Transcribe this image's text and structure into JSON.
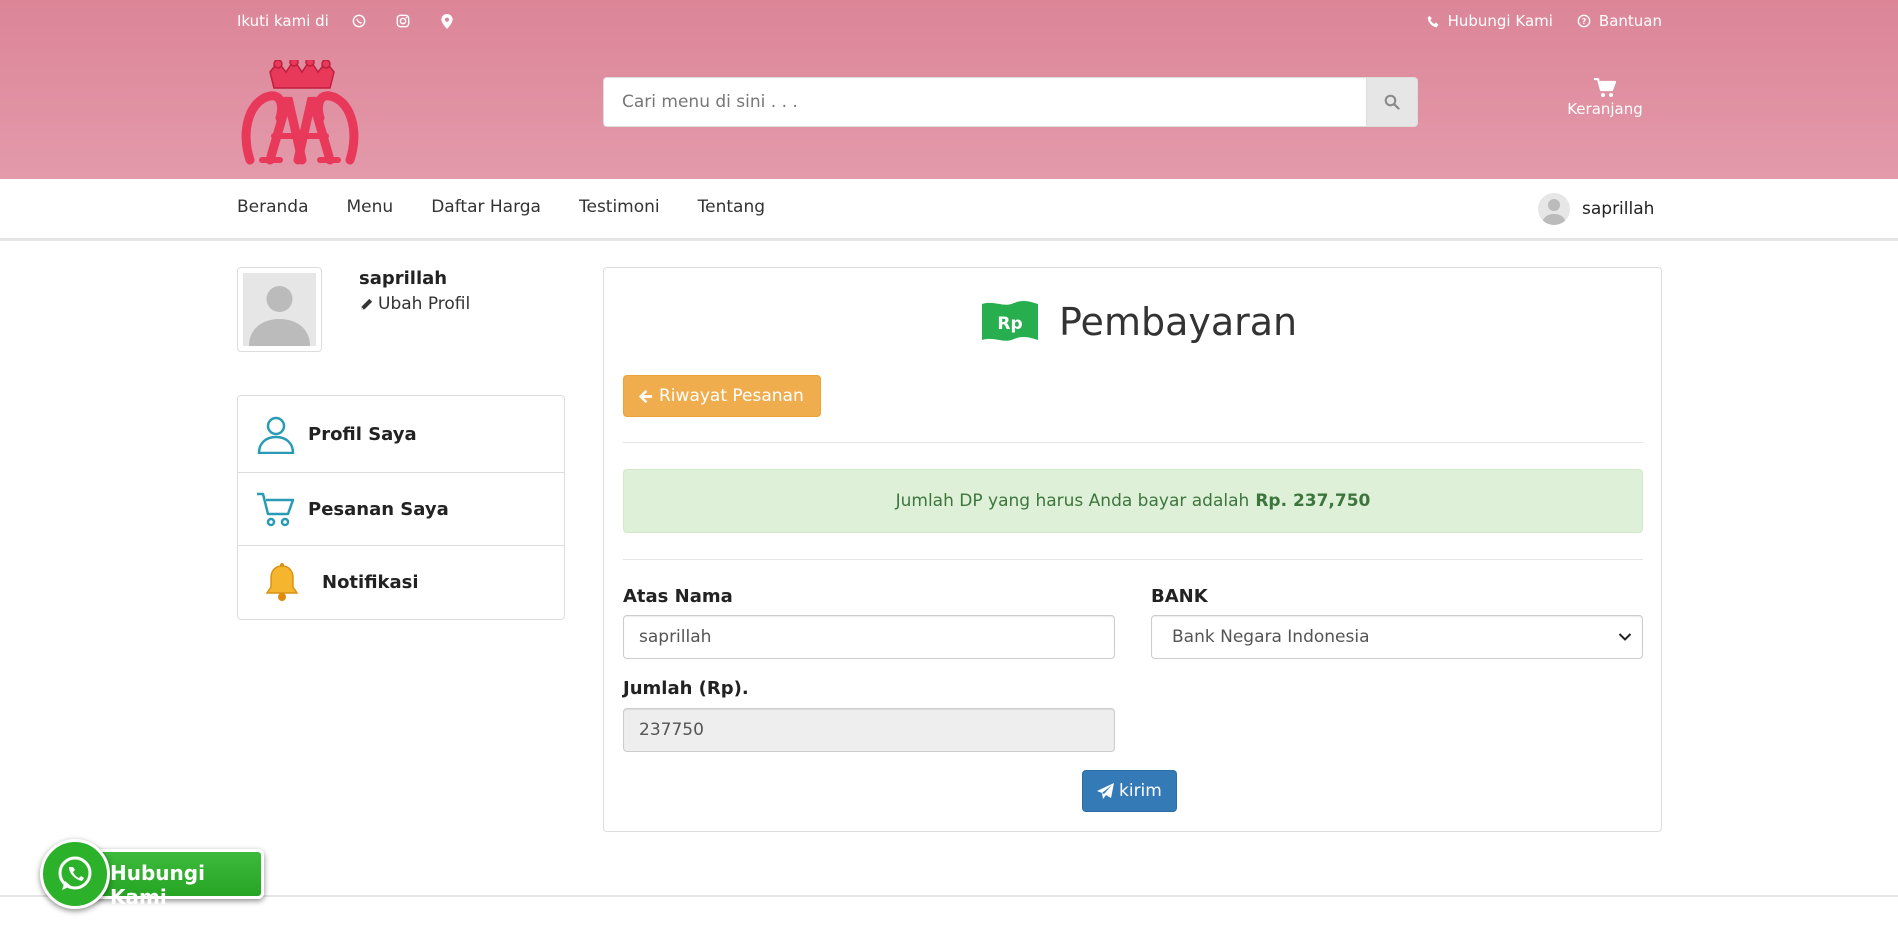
{
  "topbar": {
    "follow_label": "Ikuti kami di",
    "contact_label": "Hubungi Kami",
    "help_label": "Bantuan"
  },
  "search": {
    "placeholder": "Cari menu di sini . . ."
  },
  "cart": {
    "label": "Keranjang"
  },
  "nav": {
    "items": [
      "Beranda",
      "Menu",
      "Daftar Harga",
      "Testimoni",
      "Tentang"
    ],
    "username": "saprillah"
  },
  "profile": {
    "name": "saprillah",
    "edit_label": "Ubah Profil"
  },
  "sidebar": {
    "items": [
      {
        "label": "Profil Saya",
        "icon": "user-icon"
      },
      {
        "label": "Pesanan Saya",
        "icon": "cart-icon"
      },
      {
        "label": "Notifikasi",
        "icon": "bell-icon"
      }
    ]
  },
  "payment": {
    "title": "Pembayaran",
    "icon_text": "Rp",
    "back_label": "Riwayat Pesanan",
    "alert_text": "Jumlah DP yang harus Anda bayar adalah",
    "alert_amount": "Rp. 237,750",
    "name_label": "Atas Nama",
    "name_value": "saprillah",
    "bank_label": "BANK",
    "bank_value": "Bank Negara Indonesia",
    "amount_label": "Jumlah (Rp).",
    "amount_value": "237750",
    "submit_label": "kirim"
  },
  "whatsapp": {
    "label": "Hubungi Kami"
  },
  "colors": {
    "header_pink": "#dc8598",
    "logo_red": "#e8395a",
    "warning_orange": "#f0ad4e",
    "success_bg": "#dff0d8",
    "primary_blue": "#337ab7",
    "whatsapp_green": "#2cb12a",
    "teal_icon": "#2a9bb5"
  }
}
